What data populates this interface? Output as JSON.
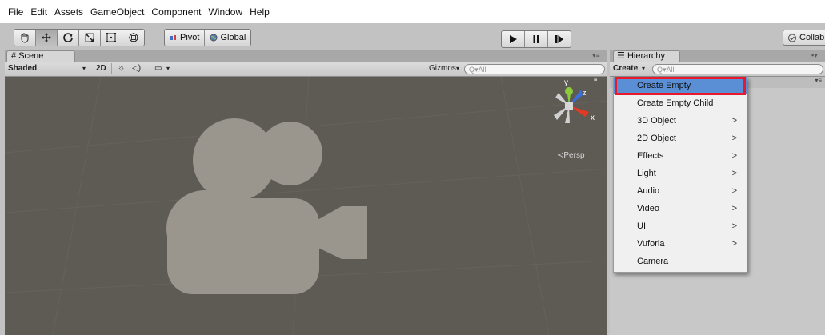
{
  "menu": [
    "File",
    "Edit",
    "Assets",
    "GameObject",
    "Component",
    "Window",
    "Help"
  ],
  "toolbar": {
    "tools": [
      {
        "icon": "hand-tool-icon"
      },
      {
        "icon": "move-tool-icon"
      },
      {
        "icon": "rotate-tool-icon"
      },
      {
        "icon": "scale-tool-icon"
      },
      {
        "icon": "rect-tool-icon"
      },
      {
        "icon": "transform-tool-icon"
      }
    ],
    "pivot_label": "Pivot",
    "global_label": "Global",
    "collab_label": "Collab"
  },
  "scene": {
    "tab_label": "Scene",
    "shading_mode": "Shaded",
    "mode_2d": "2D",
    "gizmos_label": "Gizmos",
    "search_placeholder": "All",
    "persp_label": "Persp",
    "axis_y": "y",
    "axis_z": "z",
    "axis_x": "x"
  },
  "hierarchy": {
    "tab_label": "Hierarchy",
    "create_label": "Create",
    "search_placeholder": "All"
  },
  "dropdown": {
    "items": [
      {
        "label": "Create Empty",
        "has_submenu": false,
        "selected": true
      },
      {
        "label": "Create Empty Child",
        "has_submenu": false
      },
      {
        "label": "3D Object",
        "has_submenu": true
      },
      {
        "label": "2D Object",
        "has_submenu": true
      },
      {
        "label": "Effects",
        "has_submenu": true
      },
      {
        "label": "Light",
        "has_submenu": true
      },
      {
        "label": "Audio",
        "has_submenu": true
      },
      {
        "label": "Video",
        "has_submenu": true
      },
      {
        "label": "UI",
        "has_submenu": true
      },
      {
        "label": "Vuforia",
        "has_submenu": true
      },
      {
        "label": "Camera",
        "has_submenu": false
      }
    ],
    "submenu_arrow": ">"
  },
  "colors": {
    "highlight": "#e8192c",
    "selected": "#5a8fd6",
    "viewport": "#5e5a54"
  }
}
